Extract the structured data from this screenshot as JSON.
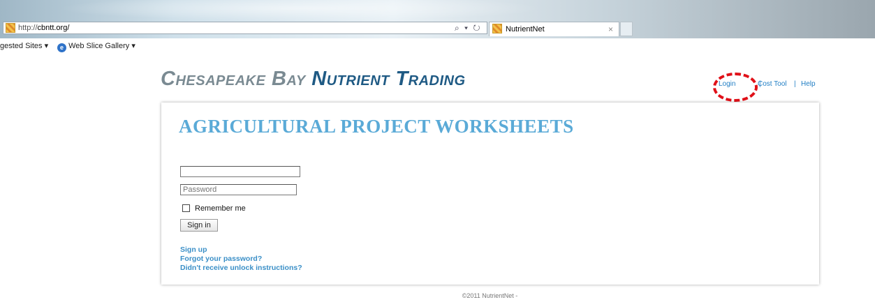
{
  "browser": {
    "address_scheme": "http://",
    "address_host": "cbntt.org/",
    "address_icons": "⌕ ▾ ↻",
    "tab_title": "NutrientNet",
    "tab_close": "×",
    "favorites": [
      {
        "label": "gested Sites ▾"
      },
      {
        "label": "Web Slice Gallery ▾"
      }
    ]
  },
  "page": {
    "title_part1": "Chesapeake Bay ",
    "title_part2": "Nutrient Trading",
    "nav": {
      "login": "Login",
      "separator": "|",
      "cost_tool": "Cost Tool",
      "help": "Help"
    },
    "card": {
      "heading": "AGRICULTURAL PROJECT WORKSHEETS",
      "username_value": "",
      "password_placeholder": "Password",
      "remember_label": "Remember me",
      "signin_label": "Sign in",
      "links": {
        "signup": "Sign up",
        "forgot": "Forgot your password?",
        "unlock": "Didn't receive unlock instructions?"
      }
    },
    "footer": "©2011 NutrientNet -"
  },
  "colors": {
    "accent_blue": "#1f5a84",
    "heading_blue": "#5aaad7",
    "link_blue": "#1f7dc4",
    "annotation_red": "#e01018"
  }
}
